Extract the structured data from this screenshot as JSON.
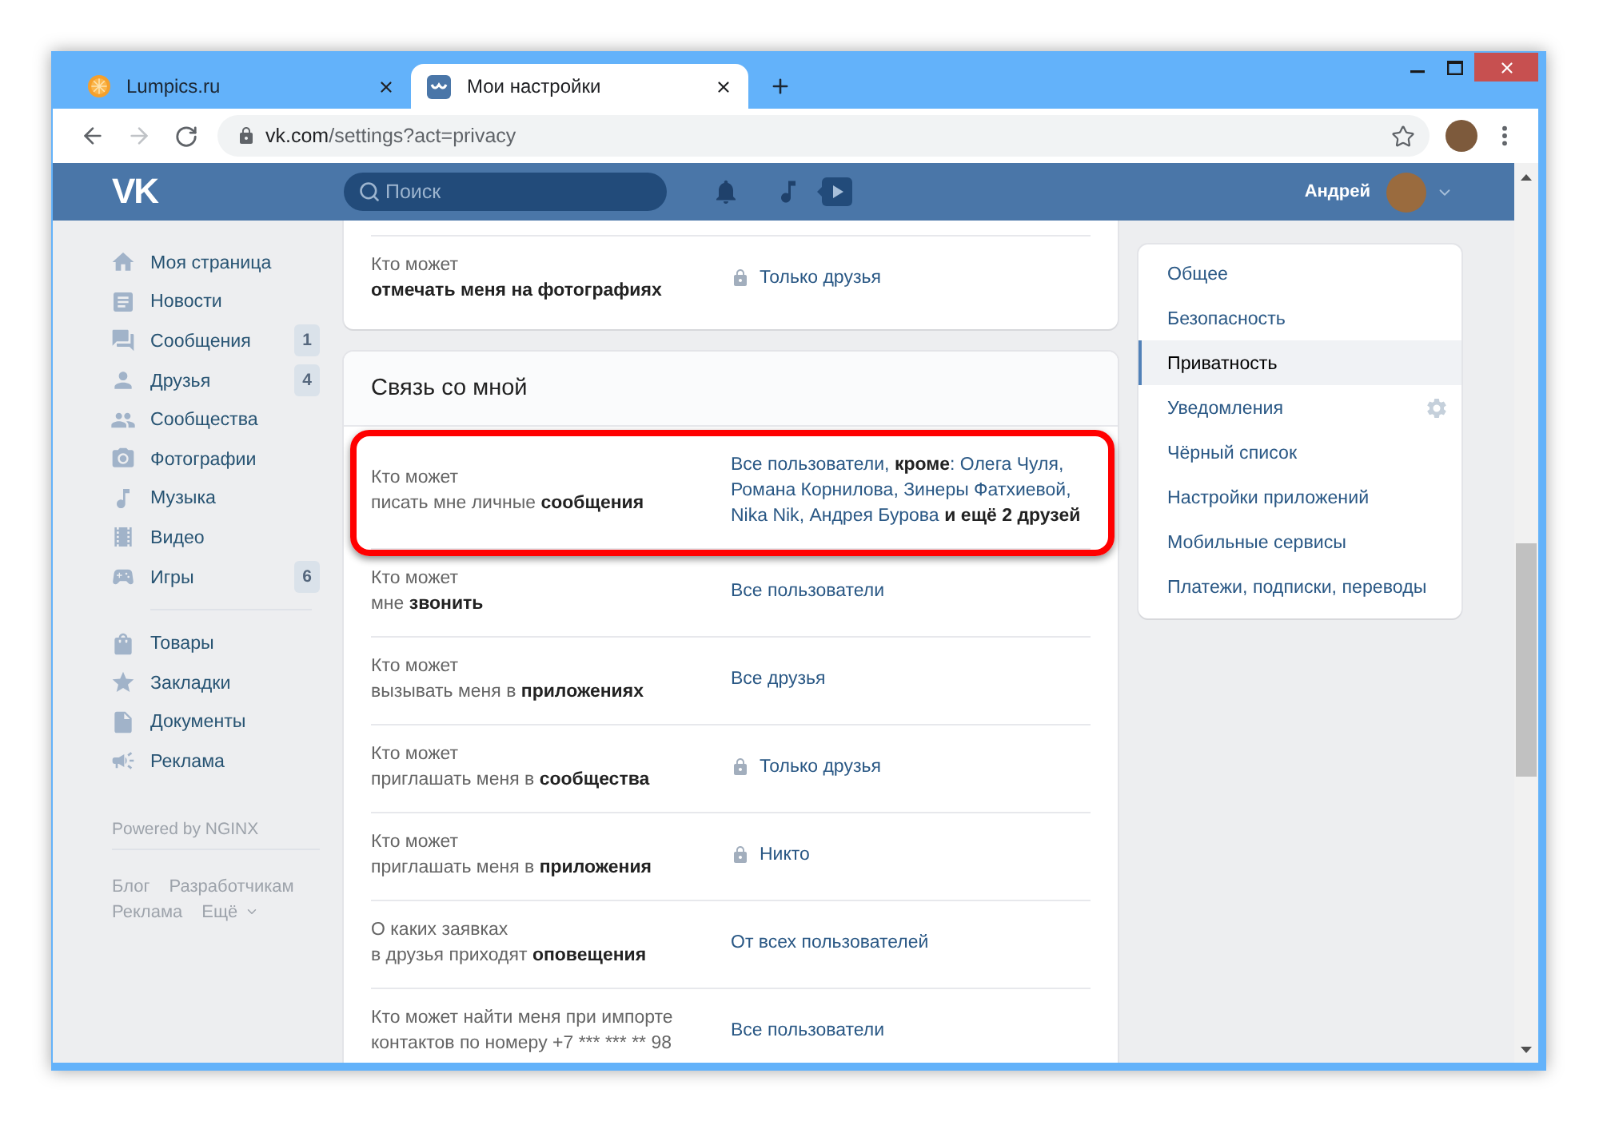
{
  "browser": {
    "tabs": [
      {
        "title": "Lumpics.ru",
        "selected": false
      },
      {
        "title": "Мои настройки",
        "selected": true
      }
    ],
    "url": {
      "host": "vk.com",
      "path": "/settings?act=privacy"
    }
  },
  "header": {
    "logo": "VK",
    "search": {
      "placeholder": "Поиск"
    },
    "user_name": "Андрей"
  },
  "sidebar": {
    "main_items": [
      {
        "label": "Моя страница"
      },
      {
        "label": "Новости"
      },
      {
        "label": "Сообщения",
        "badge": "1"
      },
      {
        "label": "Друзья",
        "badge": "4"
      },
      {
        "label": "Сообщества"
      },
      {
        "label": "Фотографии"
      },
      {
        "label": "Музыка"
      },
      {
        "label": "Видео"
      },
      {
        "label": "Игры",
        "badge": "6"
      }
    ],
    "extra_items": [
      {
        "label": "Товары"
      },
      {
        "label": "Закладки"
      },
      {
        "label": "Документы"
      },
      {
        "label": "Реклама"
      }
    ],
    "powered_by": "Powered by NGINX",
    "footer_links": [
      {
        "text": "Блог",
        "kind": "link"
      },
      {
        "text": "Разработчикам",
        "kind": "link"
      },
      {
        "text": "Реклама",
        "kind": "link"
      },
      {
        "text": "Ещё",
        "kind": "menu"
      }
    ]
  },
  "settings": {
    "sections": [
      {
        "rows": [
          {
            "label": [
              {
                "text": "Кто может"
              },
              {
                "emphasis": "отмечать меня на фотографиях"
              }
            ],
            "value": {
              "kind": "simple",
              "text": "Только друзья",
              "locked": true
            },
            "highlighted": false
          }
        ]
      },
      {
        "title": "Связь со мной",
        "rows": [
          {
            "label": [
              {
                "text": "Кто может"
              },
              {
                "text": "писать мне личные",
                "emphasis": "сообщения"
              }
            ],
            "value": {
              "kind": "exceptions",
              "parts": [
                {
                  "kind": "option",
                  "text": "Все пользователи"
                },
                {
                  "kind": "plain",
                  "text": ", "
                },
                {
                  "kind": "strong",
                  "text": "кроме"
                },
                {
                  "kind": "plain",
                  "text": ": "
                },
                {
                  "kind": "user",
                  "text": "Олега Чуля"
                },
                {
                  "kind": "plain",
                  "text": ", "
                },
                {
                  "kind": "user",
                  "text": "Романа Корнилова"
                },
                {
                  "kind": "plain",
                  "text": ", "
                },
                {
                  "kind": "user",
                  "text": "Зинеры Фатхиевой"
                },
                {
                  "kind": "plain",
                  "text": ", "
                },
                {
                  "kind": "user",
                  "text": "Nika Nik"
                },
                {
                  "kind": "plain",
                  "text": ", "
                },
                {
                  "kind": "user",
                  "text": "Андрея Бурова"
                },
                {
                  "kind": "strong",
                  "text": "и ещё 2 друзей"
                }
              ]
            },
            "highlighted": true
          },
          {
            "label": [
              {
                "text": "Кто может"
              },
              {
                "text": "мне",
                "emphasis": "звонить"
              }
            ],
            "value": {
              "kind": "simple",
              "text": "Все пользователи",
              "locked": false
            },
            "highlighted": false
          },
          {
            "label": [
              {
                "text": "Кто может"
              },
              {
                "text": "вызывать меня в",
                "emphasis": "приложениях"
              }
            ],
            "value": {
              "kind": "simple",
              "text": "Все друзья",
              "locked": false
            },
            "highlighted": false
          },
          {
            "label": [
              {
                "text": "Кто может"
              },
              {
                "text": "приглашать меня в",
                "emphasis": "сообщества"
              }
            ],
            "value": {
              "kind": "simple",
              "text": "Только друзья",
              "locked": true
            },
            "highlighted": false
          },
          {
            "label": [
              {
                "text": "Кто может"
              },
              {
                "text": "приглашать меня в",
                "emphasis": "приложения"
              }
            ],
            "value": {
              "kind": "simple",
              "text": "Никто",
              "locked": true
            },
            "highlighted": false
          },
          {
            "label": [
              {
                "text": "О каких заявках"
              },
              {
                "text": "в друзья приходят",
                "emphasis": "оповещения"
              }
            ],
            "value": {
              "kind": "simple",
              "text": "От всех пользователей",
              "locked": false
            },
            "highlighted": false
          },
          {
            "label": [
              {
                "text": "Кто может найти меня при импорте"
              },
              {
                "text": "контактов по номеру +7 *** *** ** 98"
              }
            ],
            "value": {
              "kind": "simple",
              "text": "Все пользователи",
              "locked": false
            },
            "highlighted": false
          }
        ]
      }
    ]
  },
  "settings_menu": {
    "items": [
      {
        "label": "Общее",
        "selected": false
      },
      {
        "label": "Безопасность",
        "selected": false
      },
      {
        "label": "Приватность",
        "selected": true
      },
      {
        "label": "Уведомления",
        "selected": false
      },
      {
        "label": "Чёрный список",
        "selected": false
      },
      {
        "label": "Настройки приложений",
        "selected": false
      },
      {
        "label": "Мобильные сервисы",
        "selected": false
      },
      {
        "label": "Платежи, подписки, переводы",
        "selected": false
      }
    ]
  }
}
